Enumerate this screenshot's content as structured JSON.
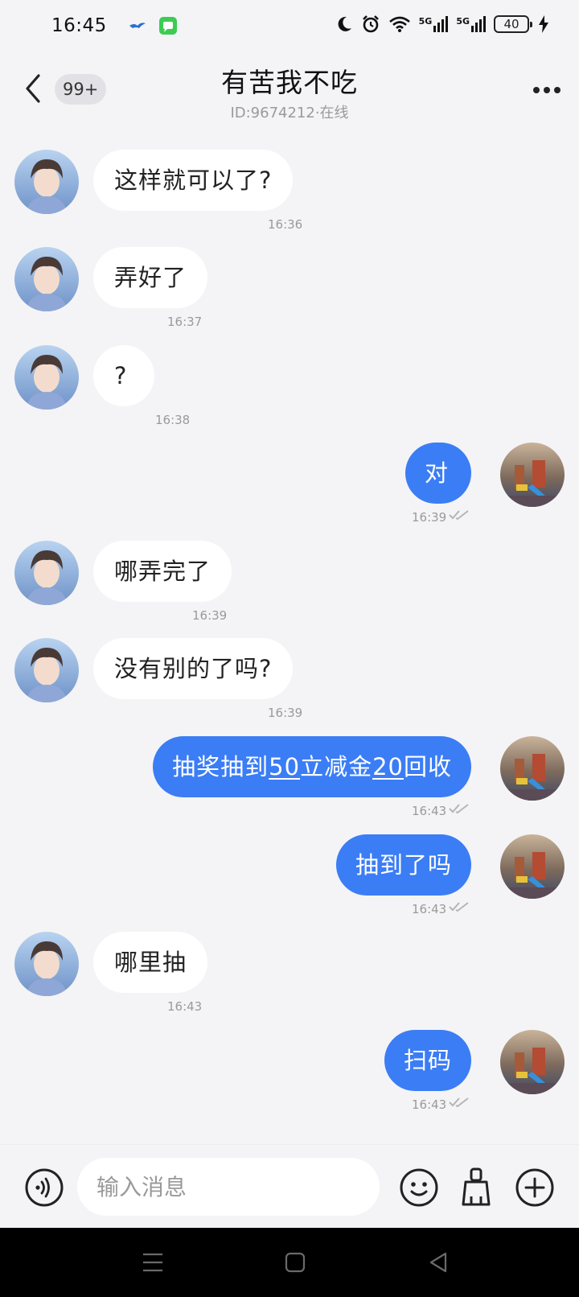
{
  "status_bar": {
    "time": "16:45",
    "network_label_1": "5G",
    "network_label_2": "5G",
    "battery": "40"
  },
  "header": {
    "unread_count": "99+",
    "title": "有苦我不吃",
    "subtitle": "ID:9674212·在线"
  },
  "messages": [
    {
      "side": "in",
      "text": "这样就可以了?",
      "time": "16:36"
    },
    {
      "side": "in",
      "text": "弄好了",
      "time": "16:37"
    },
    {
      "side": "in",
      "text": "?",
      "time": "16:38"
    },
    {
      "side": "out",
      "text": "对",
      "time": "16:39"
    },
    {
      "side": "in",
      "text": "哪弄完了",
      "time": "16:39"
    },
    {
      "side": "in",
      "text": "没有别的了吗?",
      "time": "16:39"
    },
    {
      "side": "out",
      "text_parts": [
        "抽奖抽到",
        "50",
        "立减金",
        "20",
        "回收"
      ],
      "time": "16:43"
    },
    {
      "side": "out",
      "text": "抽到了吗",
      "time": "16:43"
    },
    {
      "side": "in",
      "text": "哪里抽",
      "time": "16:43"
    },
    {
      "side": "out",
      "text": "扫码",
      "time": "16:43"
    }
  ],
  "input_bar": {
    "placeholder": "输入消息",
    "value": ""
  },
  "icons": {
    "back": "chevron-left-icon",
    "more": "more-dots-icon",
    "voice": "voice-icon",
    "emoji": "emoji-icon",
    "clean": "broom-icon",
    "plus": "plus-icon",
    "read": "double-check-icon"
  },
  "colors": {
    "outgoing_bubble": "#3b7df5",
    "incoming_bubble": "#ffffff",
    "background": "#f4f4f6",
    "secondary_text": "#9a9a9a"
  }
}
